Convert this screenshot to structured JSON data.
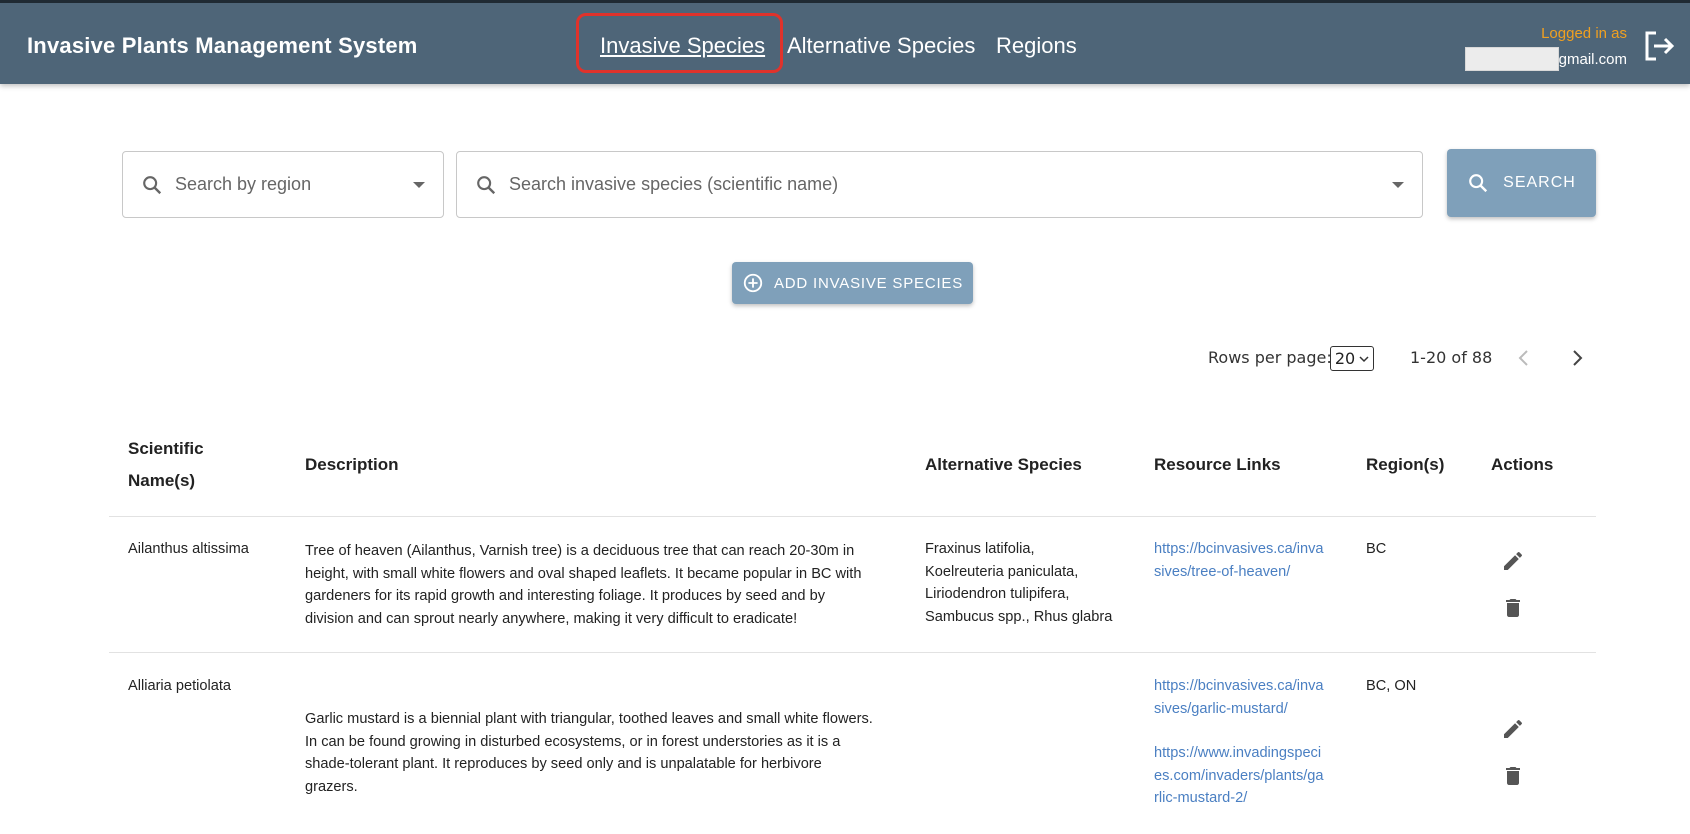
{
  "header": {
    "app_title": "Invasive Plants Management System",
    "nav": [
      {
        "label": "Invasive Species",
        "active": true
      },
      {
        "label": "Alternative Species",
        "active": false
      },
      {
        "label": "Regions",
        "active": false
      }
    ],
    "logged_in_label": "Logged in as",
    "email_suffix": "gmail.com",
    "colors": {
      "bar": "#4e6578",
      "logged_in": "#f0a020",
      "highlight": "#e0322b"
    }
  },
  "search": {
    "region_placeholder": "Search by region",
    "species_placeholder": "Search invasive species (scientific name)",
    "button_label": "SEARCH"
  },
  "add_button_label": "ADD INVASIVE SPECIES",
  "pagination": {
    "rows_per_page_label": "Rows per page:",
    "rows_per_page": "20",
    "range": "1-20 of 88"
  },
  "table": {
    "headers": {
      "scientific_line1": "Scientific",
      "scientific_line2": "Name(s)",
      "description": "Description",
      "alternatives": "Alternative Species",
      "links": "Resource Links",
      "regions": "Region(s)",
      "actions": "Actions"
    },
    "rows": [
      {
        "name": "Ailanthus altissima",
        "description": [
          "Tree of heaven (Ailanthus, Varnish tree) is a deciduous tree that can reach 20-30m in",
          "height, with small white flowers and oval shaped leaflets. It became popular in BC with",
          "gardeners for its rapid growth and interesting foliage. It produces by seed and by",
          "division and can sprout nearly anywhere, making it very difficult to eradicate!"
        ],
        "alternatives": [
          "Fraxinus latifolia,",
          "Koelreuteria paniculata,",
          "Liriodendron tulipifera,",
          "Sambucus spp., Rhus glabra"
        ],
        "links": [
          [
            "https://bcinvasives.ca/inva",
            "sives/tree-of-heaven/"
          ]
        ],
        "regions": "BC"
      },
      {
        "name": "Alliaria petiolata",
        "description": [
          "Garlic mustard is a biennial plant with triangular, toothed leaves and small white flowers.",
          "In can be found growing in disturbed ecosystems, or in forest understories as it is a",
          "shade-tolerant plant. It reproduces by seed only and is unpalatable for herbivore",
          "grazers."
        ],
        "alternatives": [],
        "links": [
          [
            "https://bcinvasives.ca/inva",
            "sives/garlic-mustard/"
          ],
          [
            "https://www.invadingspeci",
            "es.com/invaders/plants/ga",
            "rlic-mustard-2/"
          ]
        ],
        "regions": "BC, ON"
      }
    ]
  }
}
